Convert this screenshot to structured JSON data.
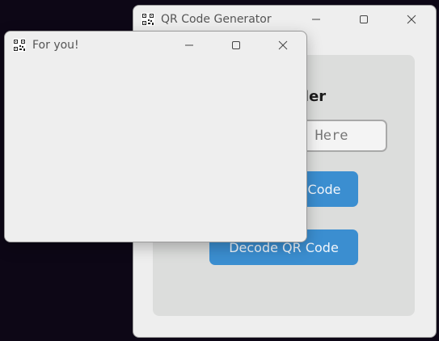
{
  "main_window": {
    "title": "QR Code Generator",
    "title_icon": "qr-icon",
    "heading_line1": "QR Code Generator & Decoder",
    "heading_line2": "",
    "heading_visible_line1": "e",
    "heading_visible_line2": "Decoder",
    "entry_placeholder": "Enter Text Here",
    "entry_visible_text": "Here",
    "generate_button_label": "Generate QR Code",
    "generate_button_visible": "Code",
    "decode_button_label": "Decode QR Code",
    "accent_color": "#3b8ed0"
  },
  "popup_window": {
    "title": "For you!",
    "title_icon": "qr-icon"
  },
  "controls": {
    "minimize": "minimize-icon",
    "maximize": "maximize-icon",
    "close": "close-icon"
  }
}
